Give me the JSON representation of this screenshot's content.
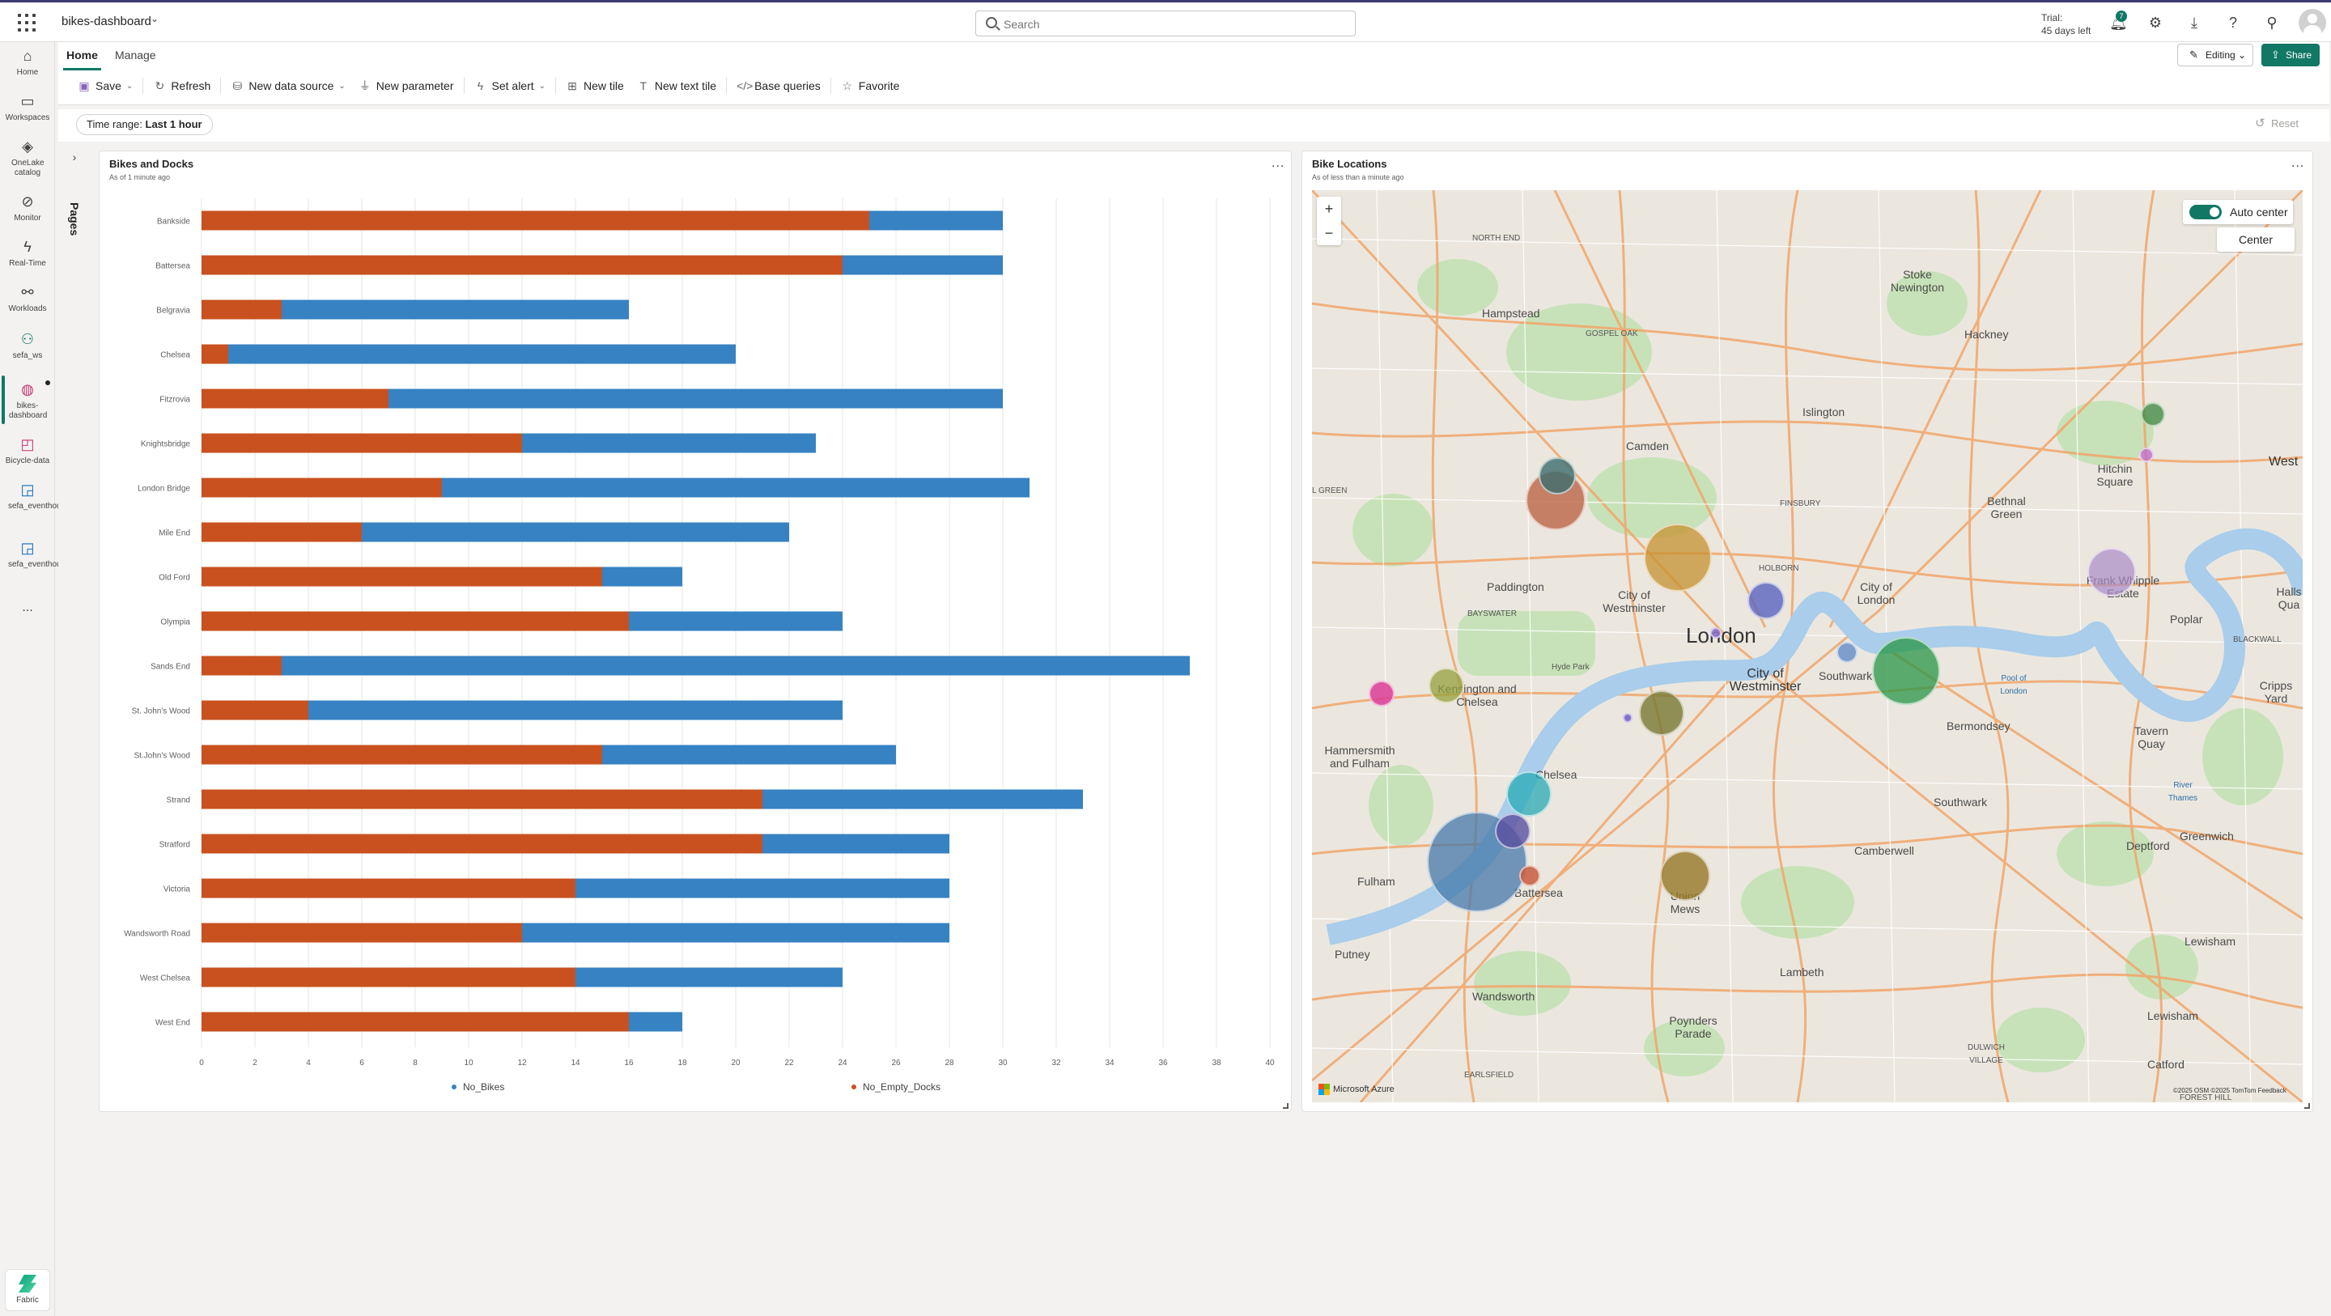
{
  "app": {
    "title": "bikes-dashboard",
    "search_placeholder": "Search",
    "trial_line1": "Trial:",
    "trial_line2": "45 days left",
    "notification_count": "7"
  },
  "rail": {
    "items": [
      {
        "label": "Home",
        "icon": "home-icon"
      },
      {
        "label": "Workspaces",
        "icon": "workspaces-icon"
      },
      {
        "label": "OneLake catalog",
        "icon": "onelake-icon"
      },
      {
        "label": "Monitor",
        "icon": "monitor-icon"
      },
      {
        "label": "Real-Time",
        "icon": "realtime-icon"
      },
      {
        "label": "Workloads",
        "icon": "workloads-icon"
      },
      {
        "label": "sefa_ws",
        "icon": "workspace-icon"
      },
      {
        "label": "bikes-dashboard",
        "icon": "dashboard-icon"
      },
      {
        "label": "Bicycle-data",
        "icon": "eventhouse-icon"
      },
      {
        "label": "sefa_eventhouse",
        "icon": "eventhouse-icon"
      },
      {
        "label": "sefa_eventhouse",
        "icon": "eventhouse-icon"
      }
    ],
    "more": "...",
    "fabric_label": "Fabric"
  },
  "ribbon": {
    "tabs": [
      "Home",
      "Manage"
    ],
    "editing_label": "Editing",
    "share_label": "Share",
    "toolbar": {
      "save": "Save",
      "refresh": "Refresh",
      "new_data_source": "New data source",
      "new_parameter": "New parameter",
      "set_alert": "Set alert",
      "new_tile": "New tile",
      "new_text_tile": "New text tile",
      "base_queries": "Base queries",
      "favorite": "Favorite"
    }
  },
  "filters": {
    "time_range_label": "Time range:",
    "time_range_value": "Last 1 hour",
    "reset_label": "Reset"
  },
  "pages_label": "Pages",
  "bikes_tile": {
    "title": "Bikes and Docks",
    "subtitle": "As of 1 minute ago",
    "more": "..."
  },
  "map_tile": {
    "title": "Bike Locations",
    "subtitle": "As of less than a minute ago",
    "more": "...",
    "auto_center_label": "Auto center",
    "center_label": "Center",
    "azure_label": "Microsoft Azure",
    "copyright": "©2025 OSM ©2025 TomTom Feedback",
    "labels": {
      "london": "London",
      "westminster": "City of Westminster",
      "hampstead": "Hampstead",
      "camden": "Camden",
      "islington": "Islington",
      "hackney": "Hackney",
      "stoke": "Stoke Newington",
      "paddington": "Paddington",
      "city_of_westminster_small": "City of Westminster",
      "city_of_london": "City of London",
      "kensington": "Kensington and Chelsea",
      "southwark": "Southwark",
      "bermondsey": "Bermondsey",
      "chelsea": "Chelsea",
      "fulham": "Fulham",
      "battersea": "Battersea",
      "hammersmith": "Hammersmith and Fulham",
      "putney": "Putney",
      "wandsworth": "Wandsworth",
      "lambeth": "Lambeth",
      "camberwell": "Camberwell",
      "union_mews": "Union Mews",
      "poynders": "Poynders Parade",
      "deptford": "Deptford",
      "greenwich": "Greenwich",
      "lewisham": "Lewisham",
      "catford": "Catford",
      "hitchin": "Hitchin Square",
      "bethnal": "Bethnal Green",
      "frank": "Frank Whipple Estate",
      "poplar": "Poplar",
      "west": "West",
      "cripps": "Cripps Yard",
      "tavern": "Tavern Quay",
      "southwark2": "Southwark",
      "north_end": "NORTH END",
      "hyde_park": "Hyde Park",
      "holborn": "HOLBORN",
      "finsbury": "FINSBURY",
      "bayswater": "BAYSWATER",
      "blackwall": "BLACKWALL",
      "gospel_oak": "GOSPEL OAK",
      "earlsfield": "EARLSFIELD",
      "forest_hill": "FOREST HILL",
      "pool_of_london": "Pool of London",
      "river_thames": "River Thames",
      "dulwich": "DULWICH VILLAGE",
      "green": "L GREEN",
      "halls": "Halls Qua"
    }
  },
  "chart_data": {
    "type": "bar",
    "orientation": "horizontal",
    "stacked": true,
    "categories": [
      "Bankside",
      "Battersea",
      "Belgravia",
      "Chelsea",
      "Fitzrovia",
      "Knightsbridge",
      "London Bridge",
      "Mile End",
      "Old Ford",
      "Olympia",
      "Sands End",
      "St. John's Wood",
      "St.John's Wood",
      "Strand",
      "Stratford",
      "Victoria",
      "Wandsworth Road",
      "West Chelsea",
      "West End"
    ],
    "series": [
      {
        "name": "No_Empty_Docks",
        "color": "#c8511f",
        "values": [
          25,
          24,
          3,
          1,
          7,
          12,
          9,
          6,
          15,
          16,
          3,
          4,
          15,
          21,
          21,
          14,
          12,
          14,
          16
        ]
      },
      {
        "name": "No_Bikes",
        "color": "#3682c3",
        "values": [
          5,
          6,
          13,
          19,
          23,
          11,
          22,
          16,
          3,
          8,
          34,
          20,
          11,
          12,
          7,
          14,
          16,
          10,
          2
        ]
      }
    ],
    "xlim": [
      0,
      40
    ],
    "xticks": [
      0,
      2,
      4,
      6,
      8,
      10,
      12,
      14,
      16,
      18,
      20,
      22,
      24,
      26,
      28,
      30,
      32,
      34,
      36,
      38,
      40
    ],
    "grid": true,
    "legend_position": "bottom",
    "legend_order": [
      "No_Bikes",
      "No_Empty_Docks"
    ]
  }
}
